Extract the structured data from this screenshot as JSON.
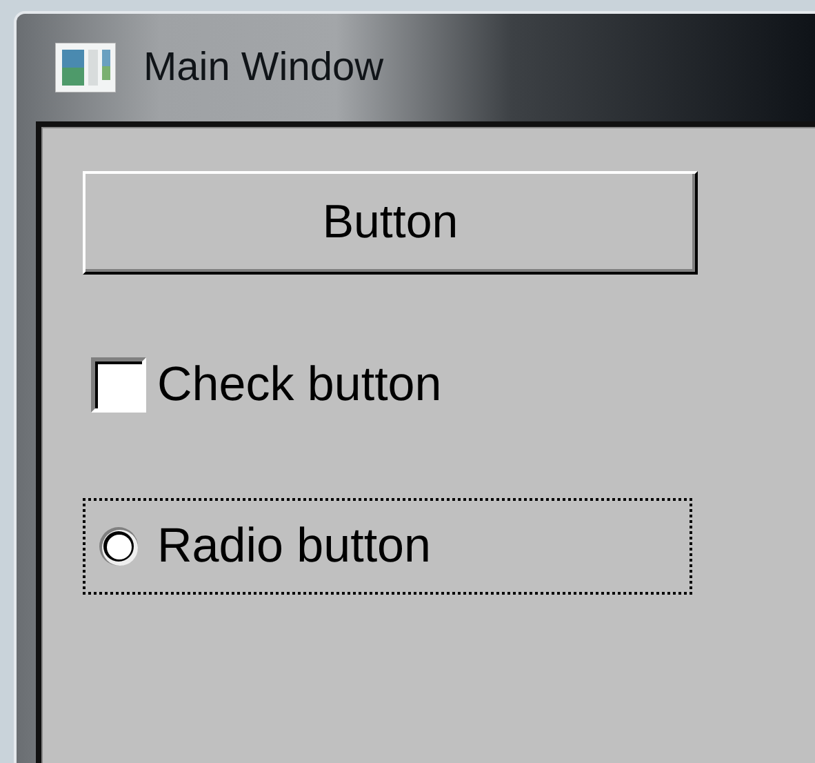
{
  "window": {
    "title": "Main Window"
  },
  "button": {
    "label": "Button"
  },
  "checkbox": {
    "label": "Check button",
    "checked": false
  },
  "radio": {
    "label": "Radio button",
    "selected": false,
    "focused": true
  }
}
